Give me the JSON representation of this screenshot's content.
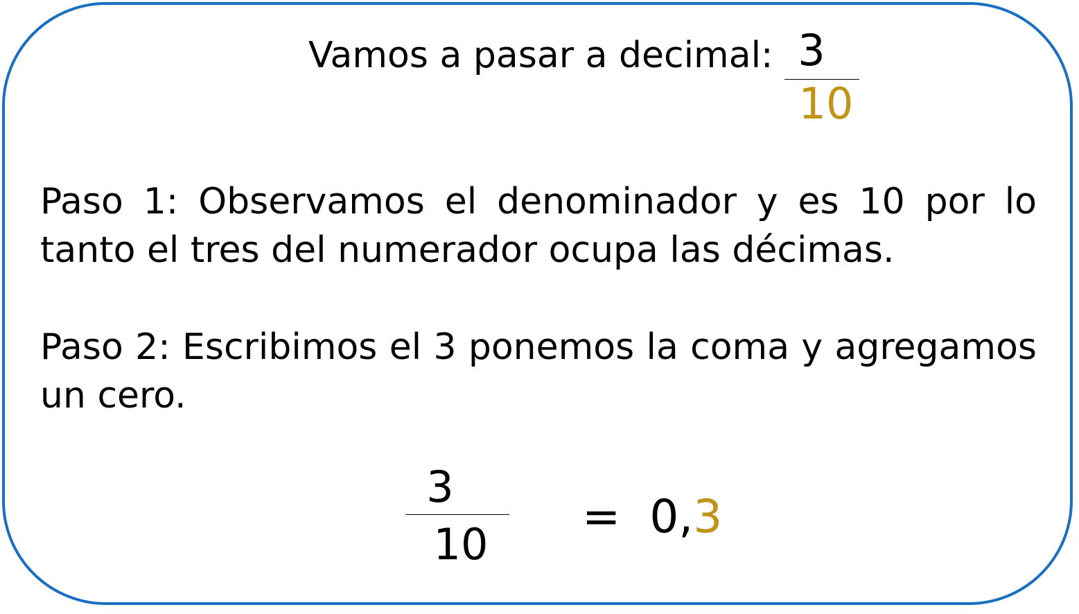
{
  "colors": {
    "border": "#1b6fc0",
    "accent": "#c09418",
    "text": "#000000"
  },
  "title": "Vamos a pasar a decimal:",
  "top_fraction": {
    "numerator": "3",
    "denominator": "10"
  },
  "step1": "Paso 1: Observamos el denominador y es 10 por lo tanto el tres del numerador ocupa las décimas.",
  "step2": "Paso 2: Escribimos el 3 ponemos la coma y agregamos un cero.",
  "result": {
    "fraction": {
      "numerator": "3",
      "denominator": "10"
    },
    "equals": "=",
    "decimal_prefix": "0,",
    "decimal_digit": "3"
  }
}
